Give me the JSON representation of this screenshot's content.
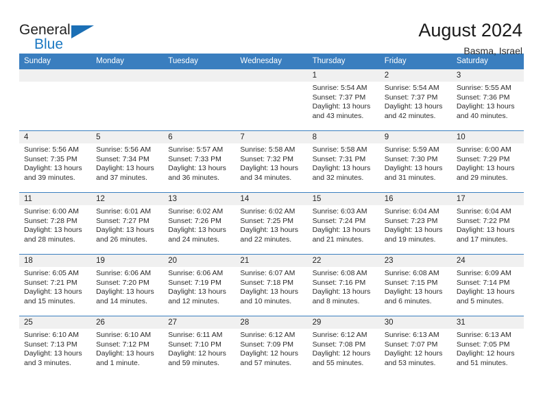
{
  "brand": {
    "name_part1": "General",
    "name_part2": "Blue",
    "triangle_color": "#1b6fb5"
  },
  "header": {
    "title": "August 2024",
    "subtitle": "Basma, Israel"
  },
  "colors": {
    "header_blue": "#3a7ebf",
    "daynum_band": "#f0f0f0",
    "text": "#2a2a2a"
  },
  "weekday_headers": [
    "Sunday",
    "Monday",
    "Tuesday",
    "Wednesday",
    "Thursday",
    "Friday",
    "Saturday"
  ],
  "weeks": [
    [
      {
        "empty": true
      },
      {
        "empty": true
      },
      {
        "empty": true
      },
      {
        "empty": true
      },
      {
        "day": "1",
        "sunrise": "Sunrise: 5:54 AM",
        "sunset": "Sunset: 7:37 PM",
        "daylight": "Daylight: 13 hours and 43 minutes."
      },
      {
        "day": "2",
        "sunrise": "Sunrise: 5:54 AM",
        "sunset": "Sunset: 7:37 PM",
        "daylight": "Daylight: 13 hours and 42 minutes."
      },
      {
        "day": "3",
        "sunrise": "Sunrise: 5:55 AM",
        "sunset": "Sunset: 7:36 PM",
        "daylight": "Daylight: 13 hours and 40 minutes."
      }
    ],
    [
      {
        "day": "4",
        "sunrise": "Sunrise: 5:56 AM",
        "sunset": "Sunset: 7:35 PM",
        "daylight": "Daylight: 13 hours and 39 minutes."
      },
      {
        "day": "5",
        "sunrise": "Sunrise: 5:56 AM",
        "sunset": "Sunset: 7:34 PM",
        "daylight": "Daylight: 13 hours and 37 minutes."
      },
      {
        "day": "6",
        "sunrise": "Sunrise: 5:57 AM",
        "sunset": "Sunset: 7:33 PM",
        "daylight": "Daylight: 13 hours and 36 minutes."
      },
      {
        "day": "7",
        "sunrise": "Sunrise: 5:58 AM",
        "sunset": "Sunset: 7:32 PM",
        "daylight": "Daylight: 13 hours and 34 minutes."
      },
      {
        "day": "8",
        "sunrise": "Sunrise: 5:58 AM",
        "sunset": "Sunset: 7:31 PM",
        "daylight": "Daylight: 13 hours and 32 minutes."
      },
      {
        "day": "9",
        "sunrise": "Sunrise: 5:59 AM",
        "sunset": "Sunset: 7:30 PM",
        "daylight": "Daylight: 13 hours and 31 minutes."
      },
      {
        "day": "10",
        "sunrise": "Sunrise: 6:00 AM",
        "sunset": "Sunset: 7:29 PM",
        "daylight": "Daylight: 13 hours and 29 minutes."
      }
    ],
    [
      {
        "day": "11",
        "sunrise": "Sunrise: 6:00 AM",
        "sunset": "Sunset: 7:28 PM",
        "daylight": "Daylight: 13 hours and 28 minutes."
      },
      {
        "day": "12",
        "sunrise": "Sunrise: 6:01 AM",
        "sunset": "Sunset: 7:27 PM",
        "daylight": "Daylight: 13 hours and 26 minutes."
      },
      {
        "day": "13",
        "sunrise": "Sunrise: 6:02 AM",
        "sunset": "Sunset: 7:26 PM",
        "daylight": "Daylight: 13 hours and 24 minutes."
      },
      {
        "day": "14",
        "sunrise": "Sunrise: 6:02 AM",
        "sunset": "Sunset: 7:25 PM",
        "daylight": "Daylight: 13 hours and 22 minutes."
      },
      {
        "day": "15",
        "sunrise": "Sunrise: 6:03 AM",
        "sunset": "Sunset: 7:24 PM",
        "daylight": "Daylight: 13 hours and 21 minutes."
      },
      {
        "day": "16",
        "sunrise": "Sunrise: 6:04 AM",
        "sunset": "Sunset: 7:23 PM",
        "daylight": "Daylight: 13 hours and 19 minutes."
      },
      {
        "day": "17",
        "sunrise": "Sunrise: 6:04 AM",
        "sunset": "Sunset: 7:22 PM",
        "daylight": "Daylight: 13 hours and 17 minutes."
      }
    ],
    [
      {
        "day": "18",
        "sunrise": "Sunrise: 6:05 AM",
        "sunset": "Sunset: 7:21 PM",
        "daylight": "Daylight: 13 hours and 15 minutes."
      },
      {
        "day": "19",
        "sunrise": "Sunrise: 6:06 AM",
        "sunset": "Sunset: 7:20 PM",
        "daylight": "Daylight: 13 hours and 14 minutes."
      },
      {
        "day": "20",
        "sunrise": "Sunrise: 6:06 AM",
        "sunset": "Sunset: 7:19 PM",
        "daylight": "Daylight: 13 hours and 12 minutes."
      },
      {
        "day": "21",
        "sunrise": "Sunrise: 6:07 AM",
        "sunset": "Sunset: 7:18 PM",
        "daylight": "Daylight: 13 hours and 10 minutes."
      },
      {
        "day": "22",
        "sunrise": "Sunrise: 6:08 AM",
        "sunset": "Sunset: 7:16 PM",
        "daylight": "Daylight: 13 hours and 8 minutes."
      },
      {
        "day": "23",
        "sunrise": "Sunrise: 6:08 AM",
        "sunset": "Sunset: 7:15 PM",
        "daylight": "Daylight: 13 hours and 6 minutes."
      },
      {
        "day": "24",
        "sunrise": "Sunrise: 6:09 AM",
        "sunset": "Sunset: 7:14 PM",
        "daylight": "Daylight: 13 hours and 5 minutes."
      }
    ],
    [
      {
        "day": "25",
        "sunrise": "Sunrise: 6:10 AM",
        "sunset": "Sunset: 7:13 PM",
        "daylight": "Daylight: 13 hours and 3 minutes."
      },
      {
        "day": "26",
        "sunrise": "Sunrise: 6:10 AM",
        "sunset": "Sunset: 7:12 PM",
        "daylight": "Daylight: 13 hours and 1 minute."
      },
      {
        "day": "27",
        "sunrise": "Sunrise: 6:11 AM",
        "sunset": "Sunset: 7:10 PM",
        "daylight": "Daylight: 12 hours and 59 minutes."
      },
      {
        "day": "28",
        "sunrise": "Sunrise: 6:12 AM",
        "sunset": "Sunset: 7:09 PM",
        "daylight": "Daylight: 12 hours and 57 minutes."
      },
      {
        "day": "29",
        "sunrise": "Sunrise: 6:12 AM",
        "sunset": "Sunset: 7:08 PM",
        "daylight": "Daylight: 12 hours and 55 minutes."
      },
      {
        "day": "30",
        "sunrise": "Sunrise: 6:13 AM",
        "sunset": "Sunset: 7:07 PM",
        "daylight": "Daylight: 12 hours and 53 minutes."
      },
      {
        "day": "31",
        "sunrise": "Sunrise: 6:13 AM",
        "sunset": "Sunset: 7:05 PM",
        "daylight": "Daylight: 12 hours and 51 minutes."
      }
    ]
  ]
}
